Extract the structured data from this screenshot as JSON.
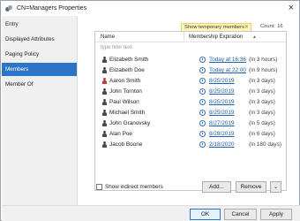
{
  "window": {
    "title": "CN=Managers Properties",
    "close_glyph": "×"
  },
  "sidebar": {
    "items": [
      {
        "label": "Entry"
      },
      {
        "label": "Displayed Attributes"
      },
      {
        "label": "Paging Policy"
      },
      {
        "label": "Members",
        "active": true
      },
      {
        "label": "Member Of"
      }
    ]
  },
  "filter_chip": {
    "label": "Show temporary members only",
    "close_glyph": "✕"
  },
  "count": {
    "label": "Count:",
    "value": "16"
  },
  "grid": {
    "columns": {
      "name": "Name",
      "expiration": "Membership Expiration",
      "sort_glyph": "▲"
    },
    "filter_placeholder": "type filter text",
    "rows": [
      {
        "name": "Elizabeth Smith",
        "date": "Today at 16:36",
        "relative": "(in 3 hours)",
        "icon": "user-icon"
      },
      {
        "name": "Elizabeth Doe",
        "date": "Today at 22:00",
        "relative": "(in 9 hours)",
        "icon": "user-icon"
      },
      {
        "name": "Aaron Smith",
        "date": "8/25/2019",
        "relative": "(in 3 days)",
        "icon": "user-disabled-icon"
      },
      {
        "name": "John Tornton",
        "date": "8/25/2019",
        "relative": "(in 3 days)",
        "icon": "user-icon"
      },
      {
        "name": "Paul Wilson",
        "date": "8/25/2019",
        "relative": "(in 3 days)",
        "icon": "user-icon"
      },
      {
        "name": "Michael Smith",
        "date": "8/25/2019",
        "relative": "(in 3 days)",
        "icon": "user-icon"
      },
      {
        "name": "John Granovsky",
        "date": "8/27/2019",
        "relative": "(in 5 days)",
        "icon": "user-icon"
      },
      {
        "name": "Alan Poe",
        "date": "8/28/2019",
        "relative": "(in 6 days)",
        "icon": "user-icon"
      },
      {
        "name": "Jacob Boone",
        "date": "2/18/2020",
        "relative": "(in 180 days)",
        "icon": "user-icon"
      }
    ]
  },
  "bottom": {
    "show_indirect_label": "Show indirect members",
    "add_label": "Add...",
    "remove_label": "Remove",
    "more_glyph": "⌄"
  },
  "footer": {
    "ok_label": "OK",
    "cancel_label": "Cancel",
    "apply_label": "Apply"
  },
  "colors": {
    "accent": "#2b74c7",
    "chip_bg": "#fff5b8",
    "link": "#1d5fb0",
    "disabled_user": "#c13b3b"
  }
}
